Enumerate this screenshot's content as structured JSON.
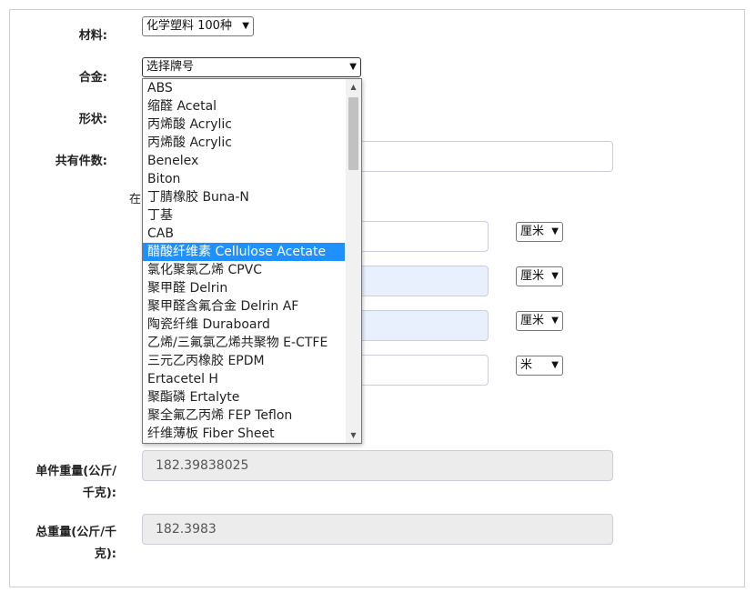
{
  "form": {
    "material_label": "材料:",
    "material_value": "化学塑料 100种",
    "alloy_label": "合金:",
    "alloy_value": "选择牌号",
    "shape_label": "形状:",
    "count_label": "共有件数:",
    "partial_text": "在",
    "unit1": "厘米",
    "unit2": "厘米",
    "unit3": "厘米",
    "unit4": "米",
    "unit_weight_label_l1": "单件重量(公斤/",
    "unit_weight_label_l2": "千克):",
    "unit_weight_value": "182.39838025",
    "total_weight_label_l1": "总重量(公斤/千",
    "total_weight_label_l2": "克):",
    "total_weight_value": "182.3983"
  },
  "dropdown": {
    "options": [
      "ABS",
      "缩醛 Acetal",
      "丙烯酸 Acrylic",
      "丙烯酸 Acrylic",
      "Benelex",
      "Biton",
      "丁腈橡胶 Buna-N",
      "丁基",
      "CAB",
      "醋酸纤维素 Cellulose Acetate",
      "氯化聚氯乙烯 CPVC",
      "聚甲醛 Delrin",
      "聚甲醛含氟合金 Delrin AF",
      "陶瓷纤维 Duraboard",
      "乙烯/三氟氯乙烯共聚物 E-CTFE",
      "三元乙丙橡胶 EPDM",
      "Ertacetel H",
      "聚酯磷 Ertalyte",
      "聚全氟乙丙烯 FEP Teflon",
      "纤维薄板 Fiber Sheet"
    ],
    "highlighted_index": 9
  },
  "icons": {
    "chevron": "chevron-down-icon",
    "scroll_up": "scroll-up-icon",
    "scroll_down": "scroll-down-icon"
  }
}
